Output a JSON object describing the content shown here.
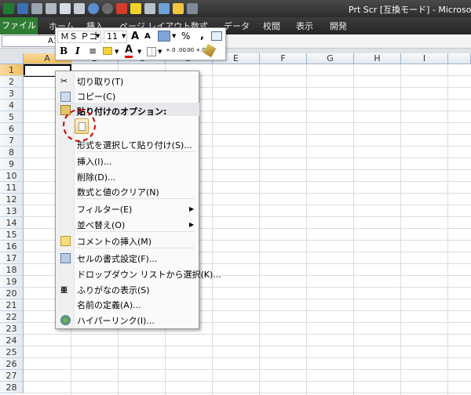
{
  "window": {
    "title": "Prt Scr [互換モード] - Microsoft"
  },
  "tabs": {
    "file": "ファイル",
    "items": [
      "ホーム",
      "挿入",
      "ページ レイアウト",
      "数式",
      "データ",
      "校閲",
      "表示",
      "開発"
    ]
  },
  "formula_bar": {
    "name_box": "A1"
  },
  "grid": {
    "columns": [
      "A",
      "B",
      "C",
      "D",
      "E",
      "F",
      "G",
      "H",
      "I"
    ],
    "rows": [
      "1",
      "2",
      "3",
      "4",
      "5",
      "6",
      "7",
      "8",
      "9",
      "10",
      "11",
      "12",
      "13",
      "14",
      "15",
      "16",
      "17",
      "18",
      "19",
      "20",
      "21",
      "22",
      "23",
      "24",
      "25",
      "26",
      "27",
      "28"
    ]
  },
  "mini_toolbar": {
    "font": "ＭＳ Ｐゴ",
    "size": "11",
    "grow": "A",
    "shrink": "A",
    "percent": "%",
    "comma": ",",
    "bold": "B",
    "italic": "I",
    "font_color": "A",
    "inc_decimal": "+.0 .00",
    "dec_decimal": ".00 +.0"
  },
  "context_menu": {
    "cut": "切り取り(T)",
    "copy": "コピー(C)",
    "paste_options": "貼り付けのオプション:",
    "paste_special": "形式を選択して貼り付け(S)...",
    "insert": "挿入(I)...",
    "delete": "削除(D)...",
    "clear": "数式と値のクリア(N)",
    "filter": "フィルター(E)",
    "sort": "並べ替え(O)",
    "comment": "コメントの挿入(M)",
    "format_cells": "セルの書式設定(F)...",
    "dropdown": "ドロップダウン リストから選択(K)...",
    "furigana": "ふりがなの表示(S)",
    "define_name": "名前の定義(A)...",
    "hyperlink": "ハイパーリンク(I)...",
    "submenu_arrow": "▶"
  },
  "colors": {
    "accent": "#2e7d32",
    "highlight": "#d40000"
  }
}
